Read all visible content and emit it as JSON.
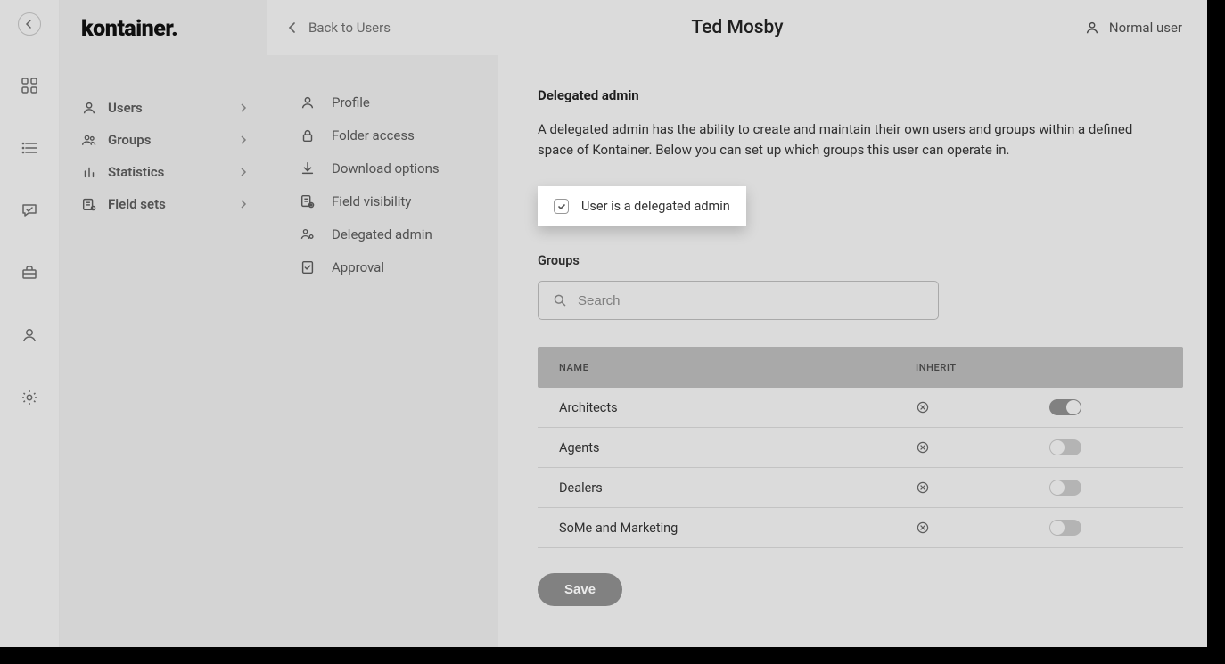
{
  "logo": "kontainer.",
  "header": {
    "back": "Back to Users",
    "title": "Ted Mosby",
    "role": "Normal user"
  },
  "sidebar": {
    "items": [
      {
        "label": "Users",
        "icon": "user"
      },
      {
        "label": "Groups",
        "icon": "users"
      },
      {
        "label": "Statistics",
        "icon": "chart"
      },
      {
        "label": "Field sets",
        "icon": "fieldset"
      }
    ]
  },
  "subnav": {
    "items": [
      {
        "label": "Profile"
      },
      {
        "label": "Folder access"
      },
      {
        "label": "Download options"
      },
      {
        "label": "Field visibility"
      },
      {
        "label": "Delegated admin"
      },
      {
        "label": "Approval"
      }
    ]
  },
  "section": {
    "title": "Delegated admin",
    "desc": "A delegated admin has the ability to create and maintain their own users and groups within a defined space of Kontainer. Below you can set up which groups this user can operate in.",
    "checkbox_label": "User is a delegated admin",
    "groups_label": "Groups",
    "search_placeholder": "Search",
    "table": {
      "col_name": "NAME",
      "col_inherit": "INHERIT",
      "rows": [
        {
          "name": "Architects",
          "toggle": true
        },
        {
          "name": "Agents",
          "toggle": false
        },
        {
          "name": "Dealers",
          "toggle": false
        },
        {
          "name": "SoMe and Marketing",
          "toggle": false
        }
      ]
    },
    "save": "Save"
  }
}
